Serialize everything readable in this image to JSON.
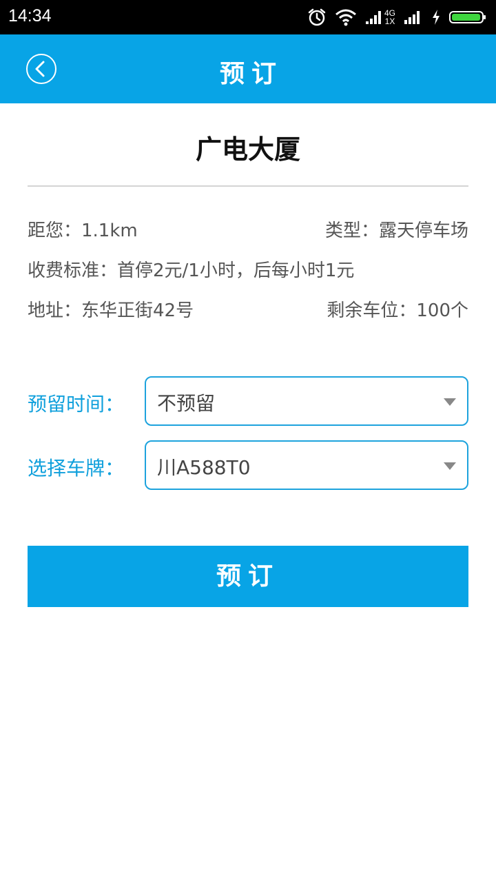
{
  "status_bar": {
    "time": "14:34",
    "network_top": "4G",
    "network_bottom": "1X",
    "icons": [
      "alarm-icon",
      "wifi-icon",
      "signal-icon",
      "signal-icon",
      "charging-icon",
      "battery-icon"
    ]
  },
  "header": {
    "back_icon": "chevron-left-circle-icon",
    "title": "预订"
  },
  "lot": {
    "name": "广电大厦",
    "distance": "距您：1.1km",
    "type": "类型：露天停车场",
    "fee": "收费标准：首停2元/1小时，后每小时1元",
    "address": "地址：东华正街42号",
    "remaining": "剩余车位：100个"
  },
  "form": {
    "reserve_time_label": "预留时间：",
    "reserve_time_value": "不预留",
    "plate_label": "选择车牌：",
    "plate_value": "川A588T0"
  },
  "submit_label": "预订",
  "colors": {
    "accent": "#08a4e6",
    "label_blue": "#10a0dc",
    "battery_green": "#3fd53f"
  }
}
